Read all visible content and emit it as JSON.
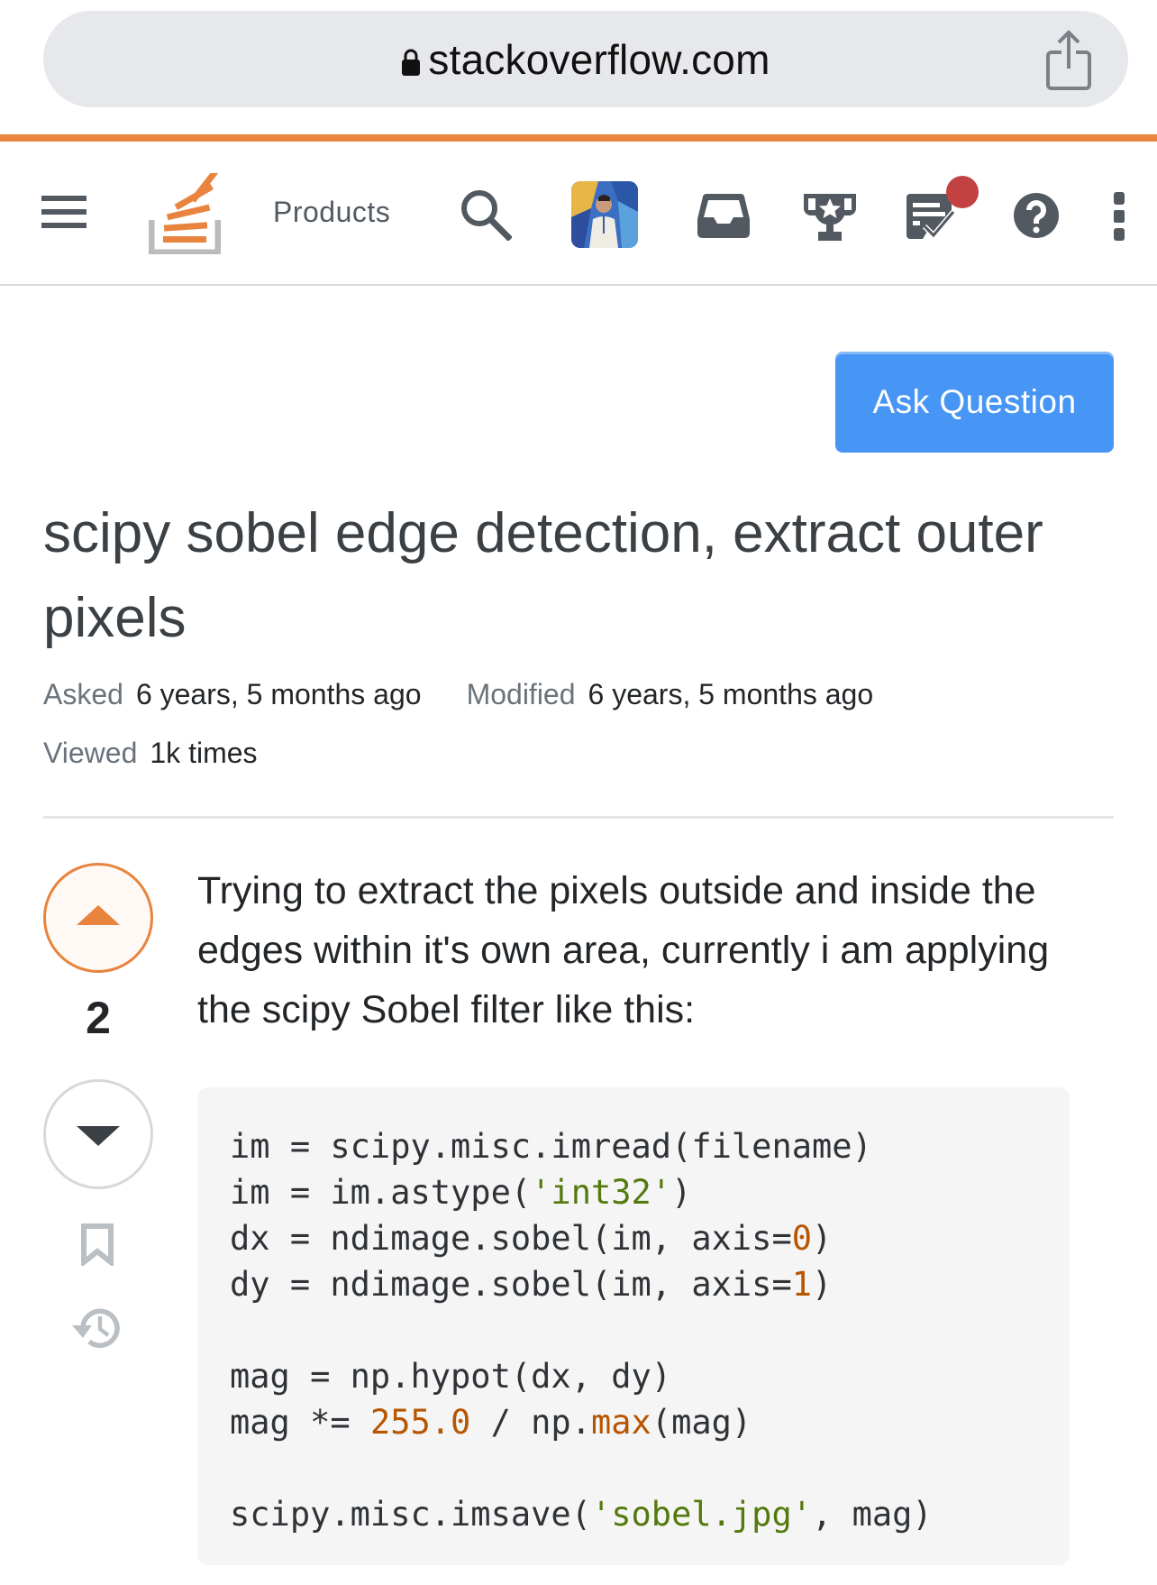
{
  "browser": {
    "url": "stackoverflow.com",
    "lock_icon": "lock-icon",
    "share_icon": "share-icon"
  },
  "nav": {
    "menu_icon": "hamburger-icon",
    "logo": "stackoverflow-logo",
    "products_label": "Products",
    "icons": [
      "search-icon",
      "avatar",
      "inbox-icon",
      "achievements-trophy-icon",
      "review-queue-icon",
      "help-icon",
      "more-icon"
    ],
    "review_badge_color": "#c24141"
  },
  "ask_button": {
    "label": "Ask Question",
    "color": "#4795f5"
  },
  "question": {
    "title": "scipy sobel edge detection, extract outer pixels",
    "meta": {
      "asked_label": "Asked",
      "asked_value": "6 years, 5 months ago",
      "modified_label": "Modified",
      "modified_value": "6 years, 5 months ago",
      "viewed_label": "Viewed",
      "viewed_value": "1k times"
    },
    "votes": {
      "count": "2",
      "upvote_icon": "upvote-arrow-icon",
      "downvote_icon": "downvote-arrow-icon",
      "bookmark_icon": "bookmark-icon",
      "history_icon": "history-icon",
      "accent_color": "#e8843d"
    },
    "body_text": "Trying to extract the pixels outside and inside the edges within it's own area, currently i am applying the scipy Sobel filter like this:",
    "code": {
      "lines": [
        [
          {
            "t": "im = scipy.misc.imread(filename)",
            "k": "plain"
          }
        ],
        [
          {
            "t": "im = im.astype(",
            "k": "plain"
          },
          {
            "t": "'int32'",
            "k": "str"
          },
          {
            "t": ")",
            "k": "plain"
          }
        ],
        [
          {
            "t": "dx = ndimage.sobel(im, axis=",
            "k": "plain"
          },
          {
            "t": "0",
            "k": "num"
          },
          {
            "t": ")",
            "k": "plain"
          }
        ],
        [
          {
            "t": "dy = ndimage.sobel(im, axis=",
            "k": "plain"
          },
          {
            "t": "1",
            "k": "num"
          },
          {
            "t": ")",
            "k": "plain"
          }
        ],
        [
          {
            "t": "",
            "k": "plain"
          }
        ],
        [
          {
            "t": "mag = np.hypot(dx, dy)",
            "k": "plain"
          }
        ],
        [
          {
            "t": "mag *= ",
            "k": "plain"
          },
          {
            "t": "255.0",
            "k": "num"
          },
          {
            "t": " / np.",
            "k": "plain"
          },
          {
            "t": "max",
            "k": "fn"
          },
          {
            "t": "(mag)",
            "k": "plain"
          }
        ],
        [
          {
            "t": "",
            "k": "plain"
          }
        ],
        [
          {
            "t": "scipy.misc.imsave(",
            "k": "plain"
          },
          {
            "t": "'sobel.jpg'",
            "k": "str"
          },
          {
            "t": ", mag)",
            "k": "plain"
          }
        ]
      ]
    }
  }
}
